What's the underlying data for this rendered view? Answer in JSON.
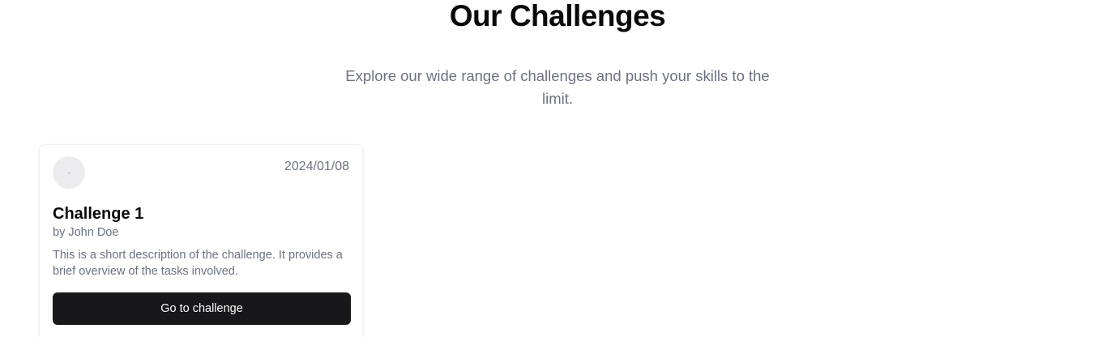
{
  "header": {
    "title": "Our Challenges",
    "subtitle": "Explore our wide range of challenges and push your skills to the limit."
  },
  "challenges": [
    {
      "date": "2024/01/08",
      "title": "Challenge 1",
      "author": "by John Doe",
      "description": "This is a short description of the challenge. It provides a brief overview of the tasks involved.",
      "button_label": "Go to challenge"
    }
  ],
  "colors": {
    "text_primary": "#09090b",
    "text_muted": "#6b7280",
    "button_bg": "#18181b",
    "button_text": "#fafafa",
    "avatar_placeholder": "#ececee"
  }
}
